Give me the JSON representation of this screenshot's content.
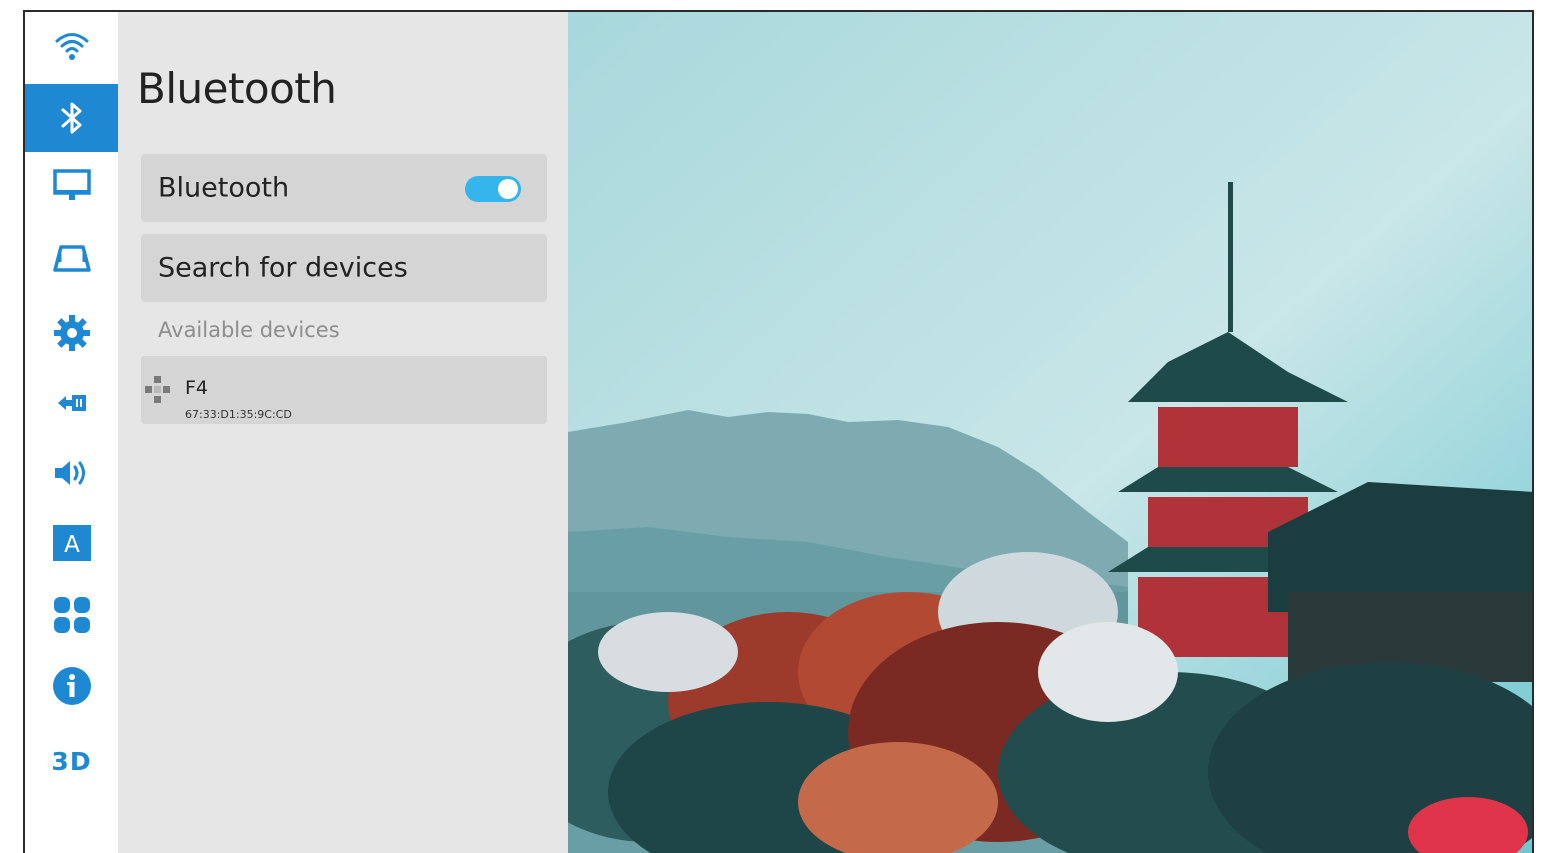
{
  "sidebar": {
    "items": [
      {
        "icon": "wifi-icon"
      },
      {
        "icon": "bluetooth-icon",
        "active": true
      },
      {
        "icon": "display-icon"
      },
      {
        "icon": "projection-icon"
      },
      {
        "icon": "settings-gear-icon"
      },
      {
        "icon": "input-source-icon"
      },
      {
        "icon": "volume-icon"
      },
      {
        "icon": "language-icon",
        "label": "A"
      },
      {
        "icon": "apps-icon"
      },
      {
        "icon": "info-icon"
      },
      {
        "icon": "3d-icon",
        "label": "3D"
      }
    ]
  },
  "panel": {
    "title": "Bluetooth",
    "bluetooth_toggle": {
      "label": "Bluetooth",
      "on": true
    },
    "search_label": "Search for devices",
    "available_label": "Available devices",
    "devices": [
      {
        "name": "F4",
        "address": "67:33:D1:35:9C:CD",
        "icon": "gamepad-icon"
      }
    ]
  },
  "colors": {
    "accent": "#1e88d2",
    "toggle_on": "#35b5ec",
    "panel_bg": "#e6e6e6",
    "card_bg": "#d5d5d5"
  },
  "wallpaper": {
    "subject": "pagoda-landscape"
  }
}
